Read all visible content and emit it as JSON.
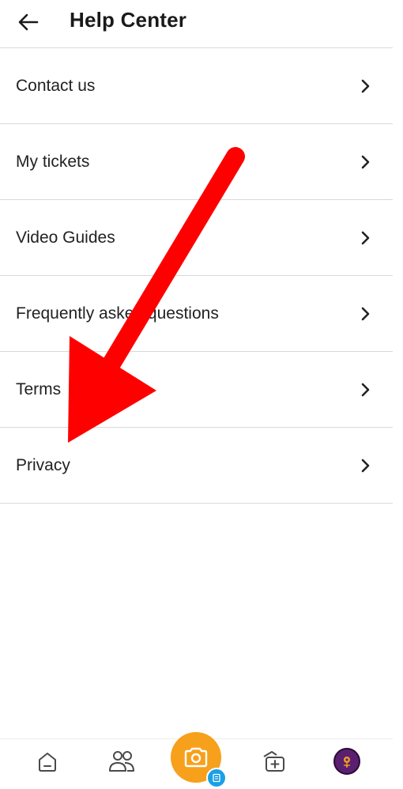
{
  "header": {
    "title": "Help Center",
    "back_icon": "arrow-left-icon"
  },
  "menu": {
    "items": [
      {
        "label": "Contact us"
      },
      {
        "label": "My tickets"
      },
      {
        "label": "Video Guides"
      },
      {
        "label": "Frequently asked questions"
      },
      {
        "label": "Terms"
      },
      {
        "label": "Privacy"
      }
    ],
    "chevron_icon": "chevron-right-icon"
  },
  "bottom_nav": {
    "items": [
      {
        "icon": "home-icon"
      },
      {
        "icon": "people-icon"
      },
      {
        "icon": "camera-icon"
      },
      {
        "icon": "add-gallery-icon"
      },
      {
        "icon": "avatar"
      }
    ],
    "camera_color": "#f7a01b",
    "badge_color": "#1aa0e6"
  },
  "annotation": {
    "arrow_color": "#ff0000"
  }
}
